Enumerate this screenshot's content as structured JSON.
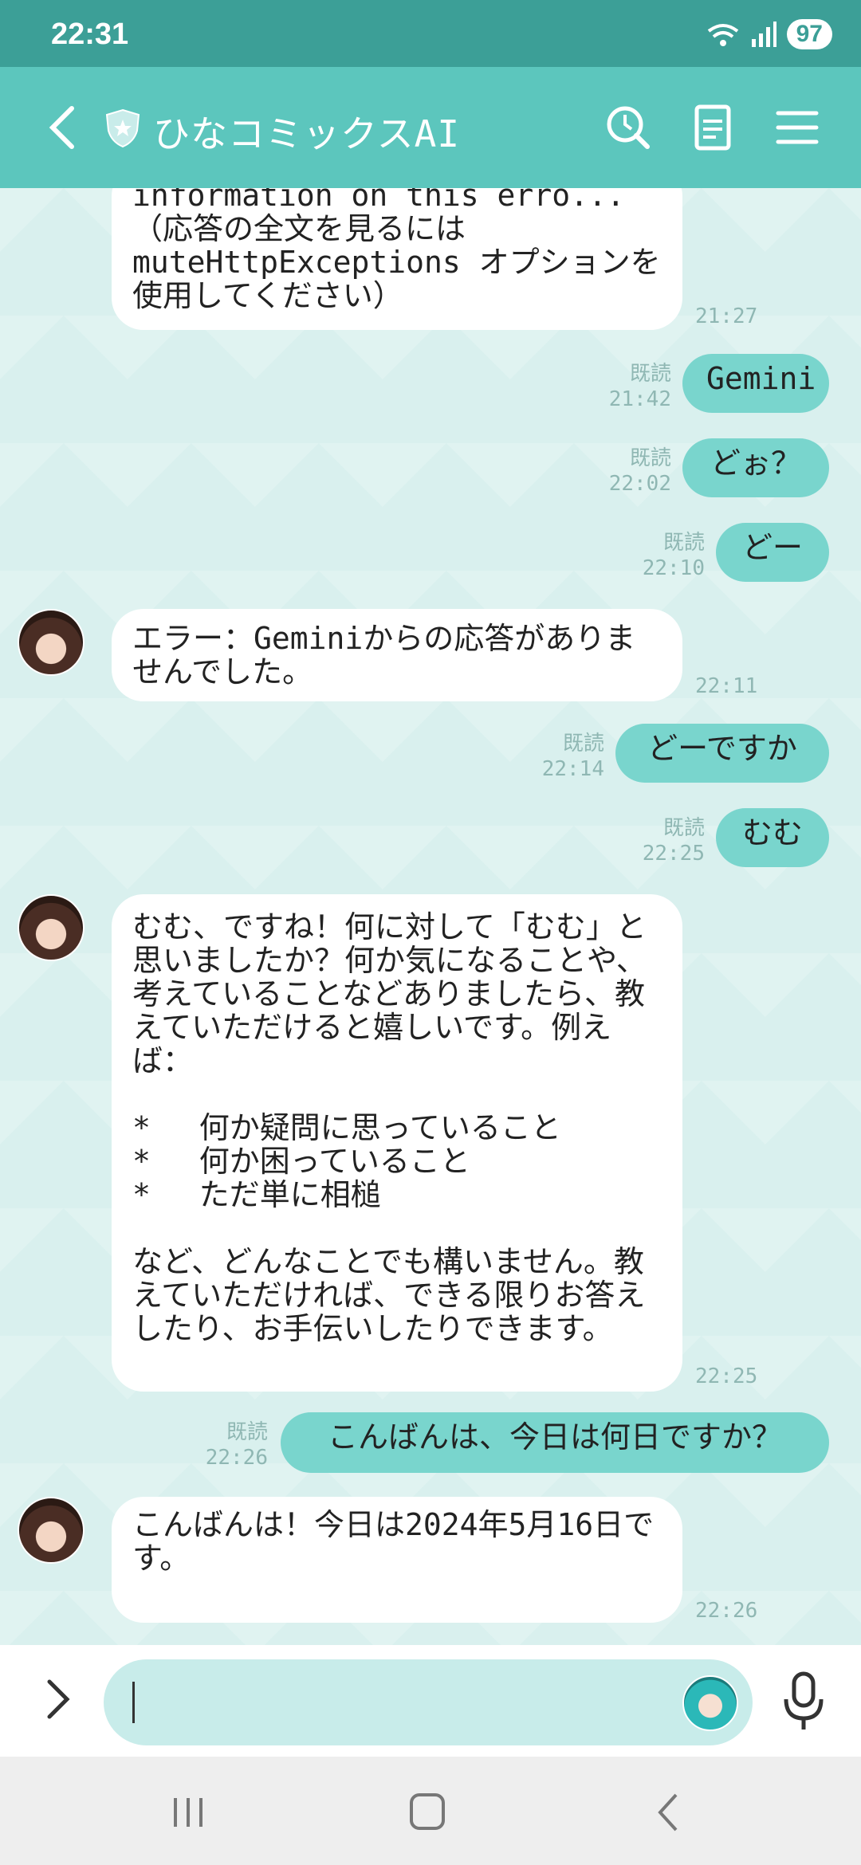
{
  "status": {
    "time": "22:31",
    "battery": "97"
  },
  "header": {
    "title": "ひなコミックスAI"
  },
  "messages": [
    {
      "text": "information on this erro...（応答の全文を見るには\nmuteHttpExceptions オプションを使用してください）",
      "time": "21:27"
    },
    {
      "text": "Gemini",
      "read": "既読",
      "time": "21:42"
    },
    {
      "text": "どぉ？",
      "read": "既読",
      "time": "22:02"
    },
    {
      "text": "どー",
      "read": "既読",
      "time": "22:10"
    },
    {
      "text": "エラー：Geminiからの応答がありませんでした。",
      "time": "22:11"
    },
    {
      "text": "どーですか",
      "read": "既読",
      "time": "22:14"
    },
    {
      "text": "むむ",
      "read": "既読",
      "time": "22:25"
    },
    {
      "text": "むむ、ですね！何に対して「むむ」と思いましたか？何か気になることや、考えていることなどありましたら、教えていただけると嬉しいです。例えば：\n\n*　 何か疑問に思っていること\n*　 何か困っていること\n*　 ただ単に相槌\n\nなど、どんなことでも構いません。教えていただければ、できる限りお答えしたり、お手伝いしたりできます。",
      "time": "22:25"
    },
    {
      "text": "こんばんは、今日は何日ですか？",
      "read": "既読",
      "time": "22:26"
    },
    {
      "text": "こんばんは！今日は2024年5月16日です。",
      "time": "22:26"
    }
  ],
  "composer": {
    "value": ""
  },
  "colors": {
    "header": "#5cc6bd",
    "statusbar": "#3c9f97",
    "bubble_out": "#79d5cd",
    "bubble_in": "#ffffff"
  },
  "icons": [
    "back-icon",
    "shield-icon",
    "history-icon",
    "notes-icon",
    "menu-icon",
    "expand-icon",
    "mic-icon",
    "recent-apps-icon",
    "home-icon",
    "nav-back-icon"
  ]
}
